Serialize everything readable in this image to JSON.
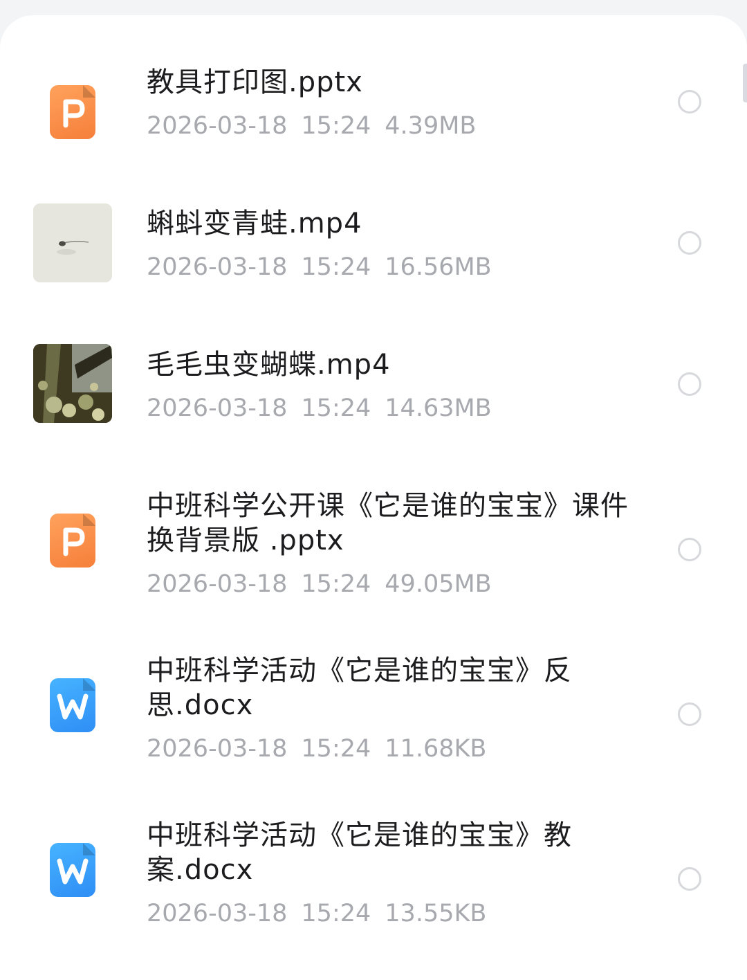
{
  "files": [
    {
      "name": "教具打印图.pptx",
      "date": "2026-03-18",
      "time": "15:24",
      "size": "4.39MB",
      "icon": "ppt-icon"
    },
    {
      "name": "蝌蚪变青蛙.mp4",
      "date": "2026-03-18",
      "time": "15:24",
      "size": "16.56MB",
      "icon": "video-thumbnail-tadpole"
    },
    {
      "name": "毛毛虫变蝴蝶.mp4",
      "date": "2026-03-18",
      "time": "15:24",
      "size": "14.63MB",
      "icon": "video-thumbnail-caterpillar"
    },
    {
      "name": "中班科学公开课《它是谁的宝宝》课件换背景版 .pptx",
      "date": "2026-03-18",
      "time": "15:24",
      "size": "49.05MB",
      "icon": "ppt-icon"
    },
    {
      "name": "中班科学活动《它是谁的宝宝》反思.docx",
      "date": "2026-03-18",
      "time": "15:24",
      "size": "11.68KB",
      "icon": "word-icon"
    },
    {
      "name": "中班科学活动《它是谁的宝宝》教案.docx",
      "date": "2026-03-18",
      "time": "15:24",
      "size": "13.55KB",
      "icon": "word-icon"
    }
  ],
  "colors": {
    "ppt": "#f5893f",
    "word": "#3a9cf8",
    "meta_text": "#a7a9ae",
    "name_text": "#1c1c1e"
  }
}
